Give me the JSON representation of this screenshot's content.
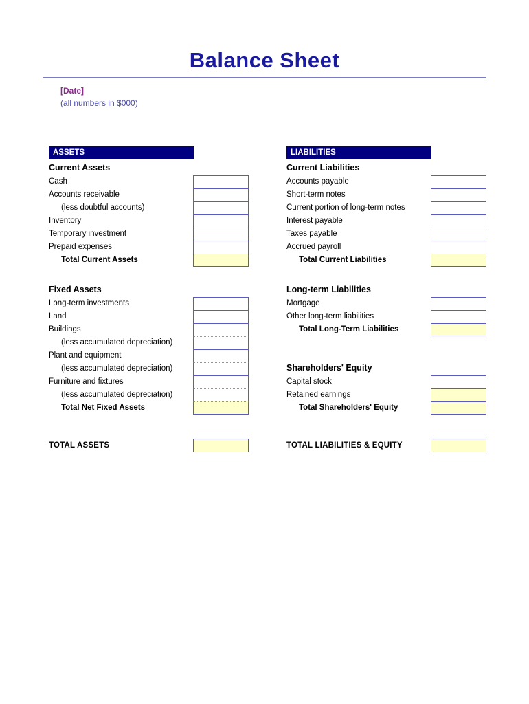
{
  "document": {
    "title": "Balance Sheet",
    "date_placeholder": "[Date]",
    "units_note": "(all numbers in $000)"
  },
  "colors": {
    "title_blue": "#1a1a9e",
    "band_navy": "#000080",
    "box_border": "#5a5ac0",
    "total_fill": "#ffffcc",
    "date_purple": "#8b2b8b",
    "units_blue": "#4a4aa8",
    "rule_blue": "#7b7bc4"
  },
  "assets": {
    "band_label": "ASSETS",
    "current": {
      "heading": "Current Assets",
      "items": [
        {
          "label": "Cash",
          "value": "",
          "indent": false,
          "fill": "white"
        },
        {
          "label": "Accounts receivable",
          "value": "",
          "indent": false,
          "fill": "white"
        },
        {
          "label": "(less doubtful accounts)",
          "value": "",
          "indent": true,
          "fill": "white"
        },
        {
          "label": "Inventory",
          "value": "",
          "indent": false,
          "fill": "white"
        },
        {
          "label": "Temporary investment",
          "value": "",
          "indent": false,
          "fill": "white"
        },
        {
          "label": "Prepaid expenses",
          "value": "",
          "indent": false,
          "fill": "white"
        }
      ],
      "total": {
        "label": "Total Current Assets",
        "value": "",
        "fill": "yellow"
      }
    },
    "fixed": {
      "heading": "Fixed Assets",
      "items": [
        {
          "label": "Long-term investments",
          "value": "",
          "indent": false,
          "fill": "white"
        },
        {
          "label": "Land",
          "value": "",
          "indent": false,
          "fill": "white"
        },
        {
          "label": "Buildings",
          "value": "",
          "indent": false,
          "fill": "white"
        },
        {
          "label": "(less accumulated depreciation)",
          "value": "",
          "indent": true,
          "fill": "white"
        },
        {
          "label": "Plant and equipment",
          "value": "",
          "indent": false,
          "fill": "white"
        },
        {
          "label": "(less accumulated depreciation)",
          "value": "",
          "indent": true,
          "fill": "white"
        },
        {
          "label": "Furniture and fixtures",
          "value": "",
          "indent": false,
          "fill": "white"
        },
        {
          "label": "(less accumulated depreciation)",
          "value": "",
          "indent": true,
          "fill": "white"
        }
      ],
      "total": {
        "label": "Total Net Fixed Assets",
        "value": "",
        "fill": "yellow"
      }
    },
    "grand_total": {
      "label": "TOTAL ASSETS",
      "value": "",
      "fill": "yellow"
    }
  },
  "liabilities": {
    "band_label": "LIABILITIES",
    "current": {
      "heading": "Current Liabilities",
      "items": [
        {
          "label": "Accounts payable",
          "value": "",
          "indent": false,
          "fill": "white"
        },
        {
          "label": "Short-term notes",
          "value": "",
          "indent": false,
          "fill": "white"
        },
        {
          "label": "Current portion of long-term notes",
          "value": "",
          "indent": false,
          "fill": "white"
        },
        {
          "label": "Interest payable",
          "value": "",
          "indent": false,
          "fill": "white"
        },
        {
          "label": "Taxes payable",
          "value": "",
          "indent": false,
          "fill": "white"
        },
        {
          "label": "Accrued payroll",
          "value": "",
          "indent": false,
          "fill": "white"
        }
      ],
      "total": {
        "label": "Total Current Liabilities",
        "value": "",
        "fill": "yellow"
      }
    },
    "longterm": {
      "heading": "Long-term Liabilities",
      "items": [
        {
          "label": "Mortgage",
          "value": "",
          "indent": false,
          "fill": "white"
        },
        {
          "label": "Other long-term liabilities",
          "value": "",
          "indent": false,
          "fill": "white"
        }
      ],
      "total": {
        "label": "Total Long-Term Liabilities",
        "value": "",
        "fill": "yellow"
      }
    },
    "equity": {
      "heading": "Shareholders' Equity",
      "items": [
        {
          "label": "Capital stock",
          "value": "",
          "indent": false,
          "fill": "white"
        },
        {
          "label": "Retained earnings",
          "value": "",
          "indent": false,
          "fill": "yellow"
        }
      ],
      "total": {
        "label": "Total Shareholders' Equity",
        "value": "",
        "fill": "yellow"
      }
    },
    "grand_total": {
      "label": "TOTAL LIABILITIES & EQUITY",
      "value": "",
      "fill": "yellow"
    }
  }
}
